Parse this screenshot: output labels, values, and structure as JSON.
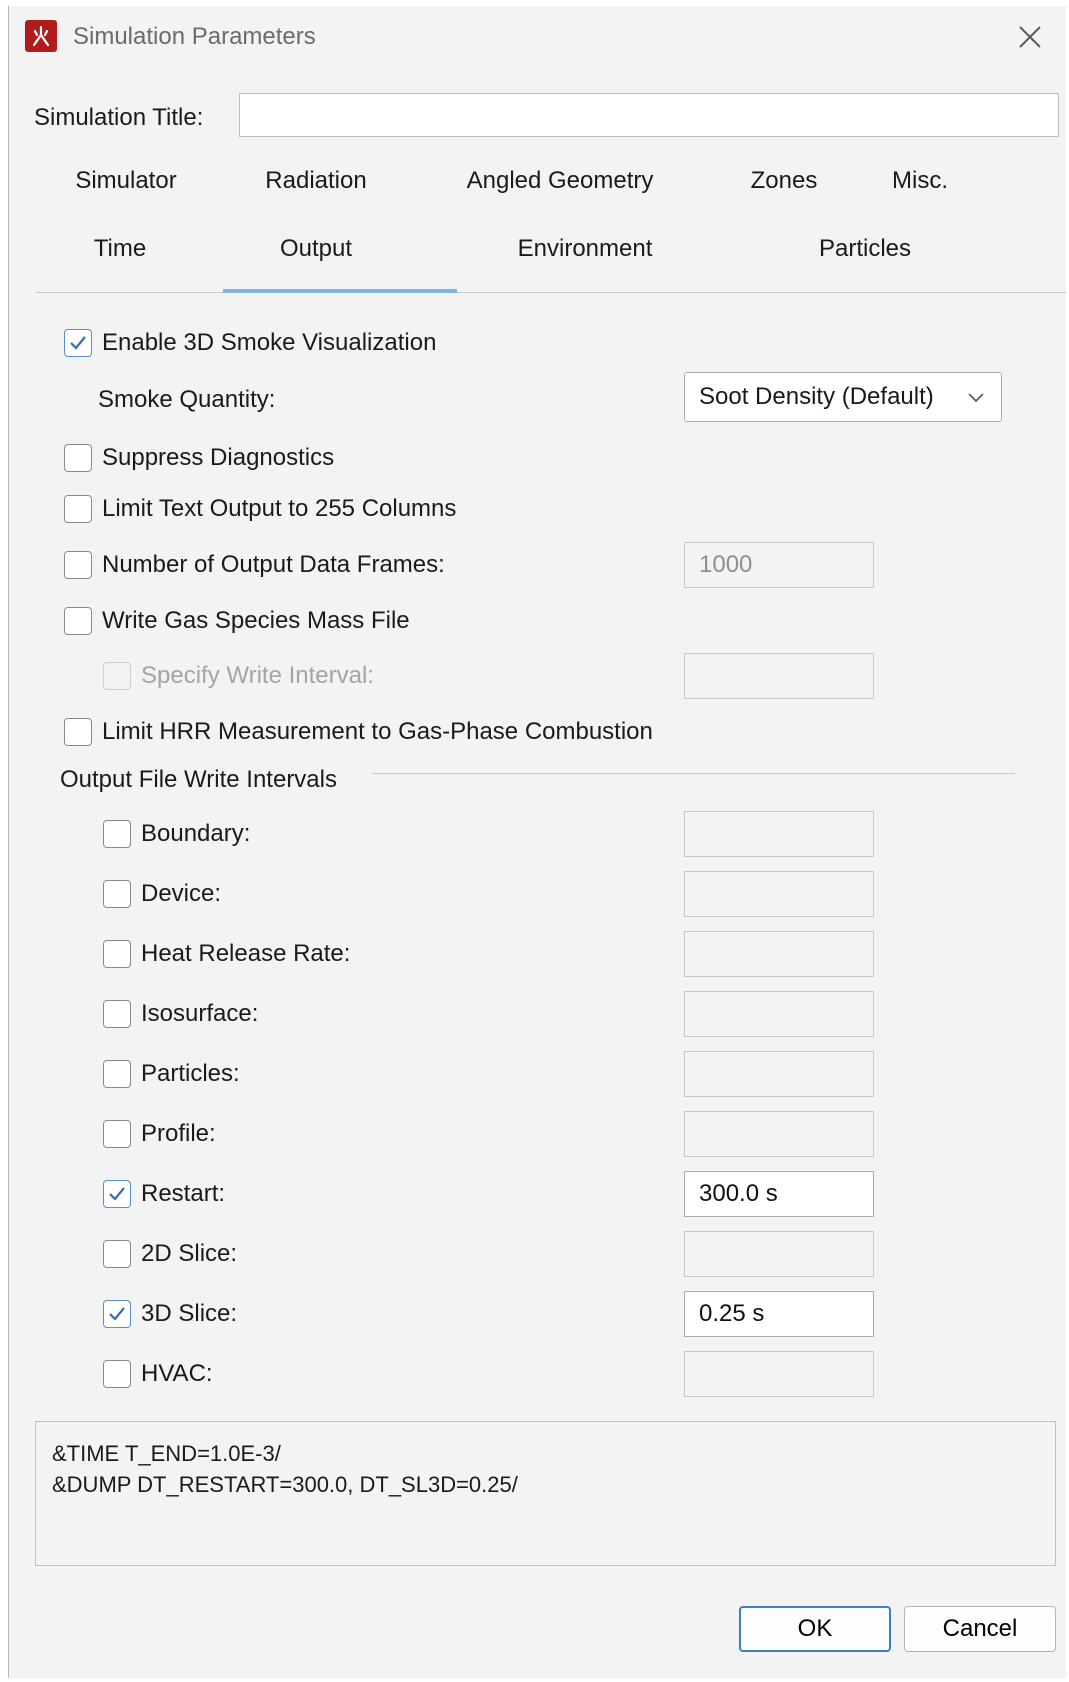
{
  "window": {
    "title": "Simulation Parameters",
    "icon": "fire-kanji-icon",
    "close_icon": "close-icon"
  },
  "sim_title": {
    "label": "Simulation Title:",
    "value": ""
  },
  "tabs": {
    "row1": [
      "Simulator",
      "Radiation",
      "Angled Geometry",
      "Zones",
      "Misc."
    ],
    "row2": [
      "Time",
      "Output",
      "Environment",
      "Particles"
    ],
    "active": "Output"
  },
  "output": {
    "enable_3d_smoke": {
      "label": "Enable 3D Smoke Visualization",
      "checked": true
    },
    "smoke_quantity": {
      "label": "Smoke Quantity:",
      "value": "Soot Density (Default)"
    },
    "suppress_diagnostics": {
      "label": "Suppress Diagnostics",
      "checked": false
    },
    "limit_text": {
      "label": "Limit Text Output to 255 Columns",
      "checked": false
    },
    "num_frames": {
      "label": "Number of Output Data Frames:",
      "checked": false,
      "value": "1000"
    },
    "write_gas_species": {
      "label": "Write Gas Species Mass File",
      "checked": false
    },
    "specify_write_interval": {
      "label": "Specify Write Interval:",
      "checked": false,
      "value": ""
    },
    "limit_hrr": {
      "label": "Limit HRR Measurement to Gas-Phase Combustion",
      "checked": false
    }
  },
  "intervals": {
    "group_label": "Output File Write Intervals",
    "items": [
      {
        "label": "Boundary:",
        "checked": false,
        "value": ""
      },
      {
        "label": "Device:",
        "checked": false,
        "value": ""
      },
      {
        "label": "Heat Release Rate:",
        "checked": false,
        "value": ""
      },
      {
        "label": "Isosurface:",
        "checked": false,
        "value": ""
      },
      {
        "label": "Particles:",
        "checked": false,
        "value": ""
      },
      {
        "label": "Profile:",
        "checked": false,
        "value": ""
      },
      {
        "label": "Restart:",
        "checked": true,
        "value": "300.0 s"
      },
      {
        "label": "2D Slice:",
        "checked": false,
        "value": ""
      },
      {
        "label": "3D Slice:",
        "checked": true,
        "value": "0.25 s"
      },
      {
        "label": "HVAC:",
        "checked": false,
        "value": ""
      }
    ]
  },
  "preview": {
    "lines": [
      "&TIME T_END=1.0E-3/",
      "&DUMP DT_RESTART=300.0, DT_SL3D=0.25/"
    ]
  },
  "buttons": {
    "ok": "OK",
    "cancel": "Cancel"
  },
  "colors": {
    "accent": "#7fb3de",
    "check": "#2f6fb5",
    "app_icon": "#b01c1c"
  }
}
